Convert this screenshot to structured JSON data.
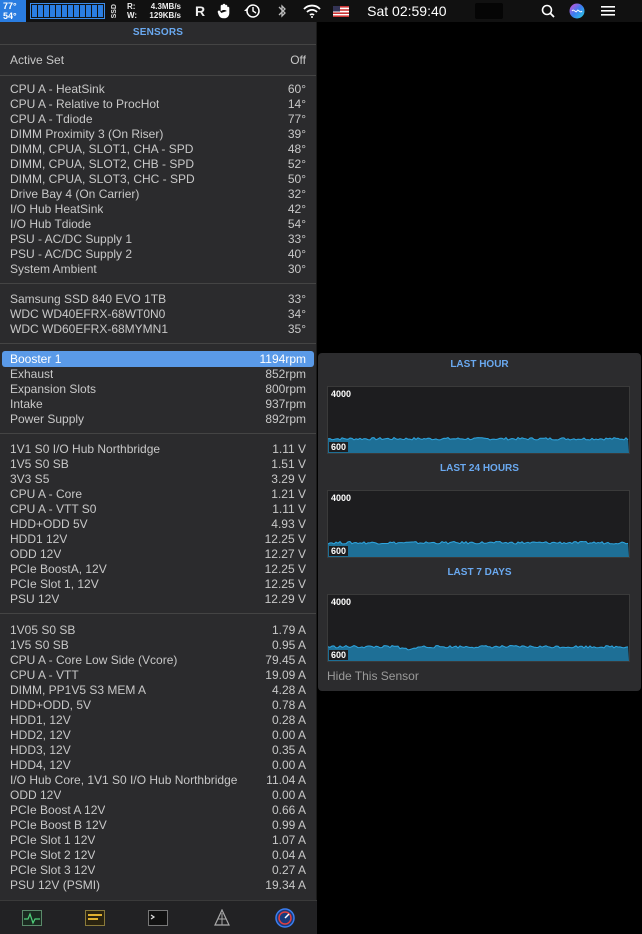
{
  "menubar": {
    "temp_top": "77°",
    "temp_bottom": "54°",
    "disk_label": "SSD",
    "read_label": "R:",
    "read_value": "4.3MB/s",
    "write_label": "W:",
    "write_value": "129KB/s",
    "clock": "Sat 02:59:40",
    "icons": [
      "r-icon",
      "hand-icon",
      "time-machine-icon",
      "bluetooth-icon",
      "wifi-icon",
      "flag-icon",
      "search-icon",
      "siri-icon",
      "menu-icon"
    ]
  },
  "panel": {
    "title": "SENSORS",
    "active_set": {
      "name": "Active Set",
      "value": "Off"
    },
    "temperature": [
      {
        "name": "CPU A - HeatSink",
        "value": "60°"
      },
      {
        "name": "CPU A - Relative to ProcHot",
        "value": "14°"
      },
      {
        "name": "CPU A - Tdiode",
        "value": "77°"
      },
      {
        "name": "DIMM Proximity 3 (On Riser)",
        "value": "39°"
      },
      {
        "name": "DIMM, CPUA, SLOT1, CHA - SPD",
        "value": "48°"
      },
      {
        "name": "DIMM, CPUA, SLOT2, CHB - SPD",
        "value": "52°"
      },
      {
        "name": "DIMM, CPUA, SLOT3, CHC - SPD",
        "value": "50°"
      },
      {
        "name": "Drive Bay 4 (On Carrier)",
        "value": "32°"
      },
      {
        "name": "I/O Hub HeatSink",
        "value": "42°"
      },
      {
        "name": "I/O Hub Tdiode",
        "value": "54°"
      },
      {
        "name": "PSU - AC/DC Supply 1",
        "value": "33°"
      },
      {
        "name": "PSU - AC/DC Supply 2",
        "value": "40°"
      },
      {
        "name": "System Ambient",
        "value": "30°"
      }
    ],
    "drives": [
      {
        "name": "Samsung SSD 840 EVO 1TB",
        "value": "33°"
      },
      {
        "name": "WDC WD40EFRX-68WT0N0",
        "value": "34°"
      },
      {
        "name": "WDC WD60EFRX-68MYMN1",
        "value": "35°"
      }
    ],
    "fans": [
      {
        "name": "Booster 1",
        "value": "1194rpm"
      },
      {
        "name": "Exhaust",
        "value": "852rpm"
      },
      {
        "name": "Expansion Slots",
        "value": "800rpm"
      },
      {
        "name": "Intake",
        "value": "937rpm"
      },
      {
        "name": "Power Supply",
        "value": "892rpm"
      }
    ],
    "voltages": [
      {
        "name": "1V1 S0 I/O Hub Northbridge",
        "value": "1.11 V"
      },
      {
        "name": "1V5 S0 SB",
        "value": "1.51 V"
      },
      {
        "name": "3V3 S5",
        "value": "3.29 V"
      },
      {
        "name": "CPU A - Core",
        "value": "1.21 V"
      },
      {
        "name": "CPU A - VTT S0",
        "value": "1.11 V"
      },
      {
        "name": "HDD+ODD 5V",
        "value": "4.93 V"
      },
      {
        "name": "HDD1 12V",
        "value": "12.25 V"
      },
      {
        "name": "ODD 12V",
        "value": "12.27 V"
      },
      {
        "name": "PCIe BoostA, 12V",
        "value": "12.25 V"
      },
      {
        "name": "PCIe Slot 1, 12V",
        "value": "12.25 V"
      },
      {
        "name": "PSU 12V",
        "value": "12.29 V"
      }
    ],
    "currents": [
      {
        "name": "1V05 S0 SB",
        "value": "1.79 A"
      },
      {
        "name": "1V5 S0 SB",
        "value": "0.95 A"
      },
      {
        "name": "CPU A - Core Low Side (Vcore)",
        "value": "79.45 A"
      },
      {
        "name": "CPU A - VTT",
        "value": "19.09 A"
      },
      {
        "name": "DIMM, PP1V5 S3 MEM A",
        "value": "4.28 A"
      },
      {
        "name": "HDD+ODD, 5V",
        "value": "0.78 A"
      },
      {
        "name": "HDD1, 12V",
        "value": "0.28 A"
      },
      {
        "name": "HDD2, 12V",
        "value": "0.00 A"
      },
      {
        "name": "HDD3, 12V",
        "value": "0.35 A"
      },
      {
        "name": "HDD4, 12V",
        "value": "0.00 A"
      },
      {
        "name": "I/O Hub Core, 1V1 S0 I/O Hub Northbridge",
        "value": "11.04 A"
      },
      {
        "name": "ODD 12V",
        "value": "0.00 A"
      },
      {
        "name": "PCIe Boost A 12V",
        "value": "0.66 A"
      },
      {
        "name": "PCIe Boost B 12V",
        "value": "0.99 A"
      },
      {
        "name": "PCIe Slot 1 12V",
        "value": "1.07 A"
      },
      {
        "name": "PCIe Slot 2 12V",
        "value": "0.04 A"
      },
      {
        "name": "PCIe Slot 3 12V",
        "value": "0.27 A"
      },
      {
        "name": "PSU 12V (PSMI)",
        "value": "19.34 A"
      }
    ],
    "selected_fan": "Booster 1",
    "tabs": [
      "cpu-monitor-icon",
      "memory-icon",
      "terminal-icon",
      "network-icon",
      "sensors-gauge-icon"
    ]
  },
  "popover": {
    "graphs": [
      {
        "title": "LAST HOUR",
        "max_label": "4000",
        "min_label": "600"
      },
      {
        "title": "LAST 24 HOURS",
        "max_label": "4000",
        "min_label": "600"
      },
      {
        "title": "LAST 7 DAYS",
        "max_label": "4000",
        "min_label": "600"
      }
    ],
    "hide_label": "Hide This Sensor"
  },
  "colors": {
    "accent": "#6aa9f0",
    "selection": "#5a9ae8",
    "graph_fill": "#1e6f96",
    "graph_line": "#2ea6e0"
  }
}
